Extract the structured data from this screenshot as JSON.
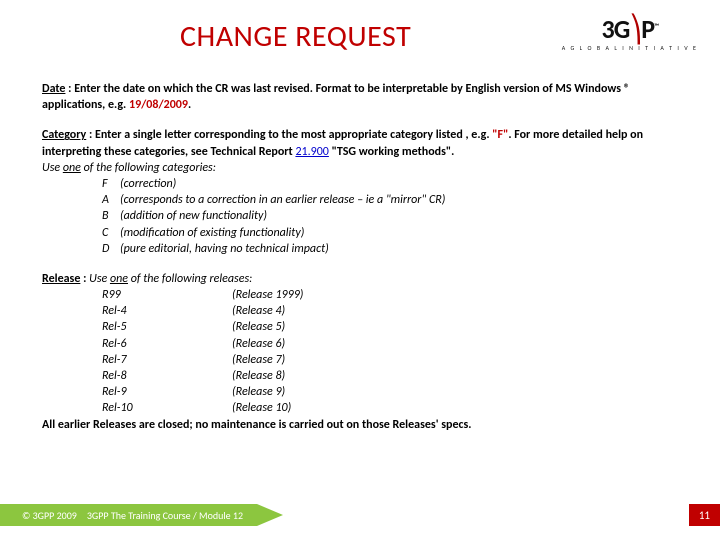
{
  "header": {
    "title": "CHANGE REQUEST",
    "logo_mark": "3GPP",
    "logo_tm": "™",
    "logo_tagline": "A  G L O B A L  I N I T I A T I V E"
  },
  "date": {
    "label": "Date",
    "sep": " : ",
    "body_a": "Enter the date on which the CR was last revised.  Format to be interpretable by English version of MS Windows ® applications, e.g. ",
    "example": "19/08/2009",
    "period": "."
  },
  "category": {
    "label": "Category",
    "sep": " : ",
    "body_a": "Enter a single letter corresponding to the most appropriate category listed , e.g. ",
    "example": "\"F\"",
    "body_b": ". For more detailed help on interpreting these categories, see Technical Report ",
    "link_text": "21.900",
    "body_c": " \"TSG working methods\".",
    "use_prefix": "Use ",
    "use_word": "one",
    "use_suffix": " of the following categories:",
    "items": [
      {
        "code": "F",
        "desc": "(correction)"
      },
      {
        "code": "A",
        "desc": "(corresponds to a correction in an earlier release – ie a \"mirror\" CR)"
      },
      {
        "code": "B",
        "desc": "(addition of new functionality)"
      },
      {
        "code": "C",
        "desc": "(modification of existing functionality)"
      },
      {
        "code": "D",
        "desc": "(pure editorial, having no technical impact)"
      }
    ]
  },
  "release": {
    "label": "Release",
    "sep": " : ",
    "use_prefix": "Use ",
    "use_word": "one",
    "use_suffix": " of the following releases:",
    "items": [
      {
        "code": "R99",
        "desc": "(Release 1999)"
      },
      {
        "code": "Rel-4",
        "desc": "(Release 4)"
      },
      {
        "code": "Rel-5",
        "desc": "(Release 5)"
      },
      {
        "code": "Rel-6",
        "desc": "(Release 6)"
      },
      {
        "code": "Rel-7",
        "desc": "(Release 7)"
      },
      {
        "code": "Rel-8",
        "desc": "(Release 8)"
      },
      {
        "code": "Rel-9",
        "desc": "(Release 9)"
      },
      {
        "code": "Rel-10",
        "desc": "(Release 10)"
      }
    ],
    "closing": "All earlier Releases are closed; no maintenance is carried out on those Releases' specs."
  },
  "footer": {
    "copyright": "© 3GPP 2009",
    "course": "3GPP The Training Course / Module 12",
    "page": "11"
  }
}
